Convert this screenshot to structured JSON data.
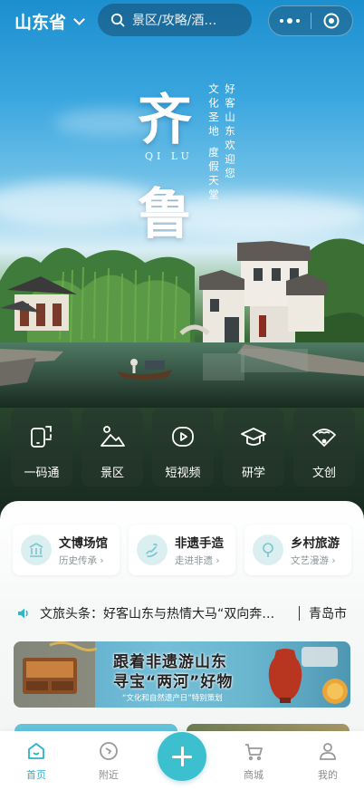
{
  "header": {
    "province": "山东省",
    "search_placeholder": "景区/攻略/酒…"
  },
  "hero": {
    "char_1": "齐",
    "char_2": "鲁",
    "pinyin": "QI LU",
    "slogan_right": "好客山东欢迎您",
    "slogan_left": "文化圣地 度假天堂"
  },
  "services": [
    {
      "label": "一码通",
      "icon": "scan-code-icon"
    },
    {
      "label": "景区",
      "icon": "scenic-mountain-icon"
    },
    {
      "label": "短视频",
      "icon": "video-play-icon"
    },
    {
      "label": "研学",
      "icon": "graduation-cap-icon"
    },
    {
      "label": "文创",
      "icon": "fan-icon"
    }
  ],
  "categories": [
    {
      "title": "文博场馆",
      "subtitle": "历史传承",
      "icon": "museum-icon"
    },
    {
      "title": "非遗手造",
      "subtitle": "走进非遗",
      "icon": "hand-craft-icon"
    },
    {
      "title": "乡村旅游",
      "subtitle": "文艺漫游",
      "icon": "tree-icon"
    }
  ],
  "ticker": {
    "text": "文旅头条：好客山东与热情大马“双向奔…",
    "city": "青岛市"
  },
  "banner": {
    "line1": "跟着非遗游山东",
    "line2": "寻宝“两河”好物",
    "line3": "“文化和自然遗产日”特别策划"
  },
  "tabbar": {
    "home": "首页",
    "nearby": "附近",
    "mall": "商城",
    "mine": "我的"
  },
  "colors": {
    "accent": "#3cc0d0",
    "active_tab": "#2bb3c9",
    "category_icon_bg": "#dbeff1"
  }
}
